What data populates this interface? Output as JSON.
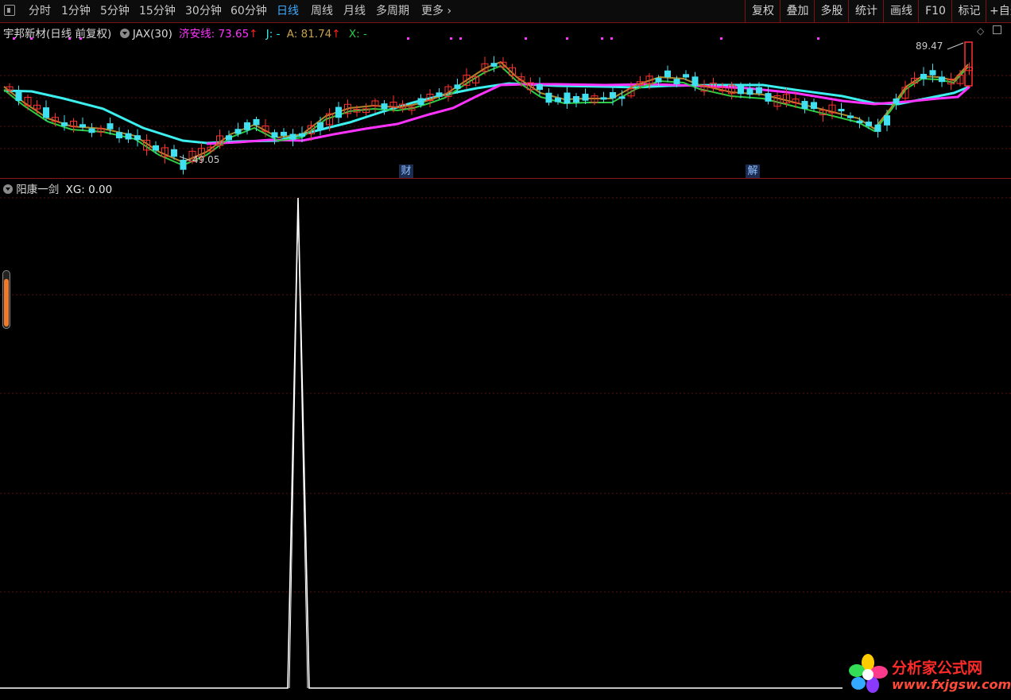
{
  "toolbar": {
    "periods": [
      {
        "label": "分时",
        "active": false
      },
      {
        "label": "1分钟",
        "active": false
      },
      {
        "label": "5分钟",
        "active": false
      },
      {
        "label": "15分钟",
        "active": false
      },
      {
        "label": "30分钟",
        "active": false
      },
      {
        "label": "60分钟",
        "active": false
      },
      {
        "label": "日线",
        "active": true
      },
      {
        "label": "周线",
        "active": false
      },
      {
        "label": "月线",
        "active": false
      },
      {
        "label": "多周期",
        "active": false
      }
    ],
    "more_label": "更多",
    "right_buttons": [
      "复权",
      "叠加",
      "多股",
      "统计",
      "画线",
      "F10",
      "标记",
      "+自选"
    ]
  },
  "main_chart": {
    "stock_title": "宇邦新材(日线 前复权)",
    "indicator_name": "JAX(30)",
    "jiaxian_label": "济安线: 73.65",
    "j_label": "J: -",
    "a_label": "A: 81.74",
    "x_label": "X: -",
    "high_price_label": "89.47",
    "low_price_label": "49.05",
    "event_markers": [
      "财",
      "解"
    ],
    "colors": {
      "jiaxian": "#ff33ff",
      "j_line": "#3cf0f0",
      "a_line": "#b08a2a",
      "x_line": "#2ecc40",
      "up": "#ff3030",
      "down": "#40e0f0",
      "arrow": "#ff2020"
    }
  },
  "sub_chart": {
    "indicator_title": "阳康一剑",
    "xg_label": "XG: 0.00",
    "colors": {
      "signal": "#ffffff"
    }
  },
  "watermark": {
    "title": "分析家公式网",
    "url": "www.fxjgsw.com"
  }
}
